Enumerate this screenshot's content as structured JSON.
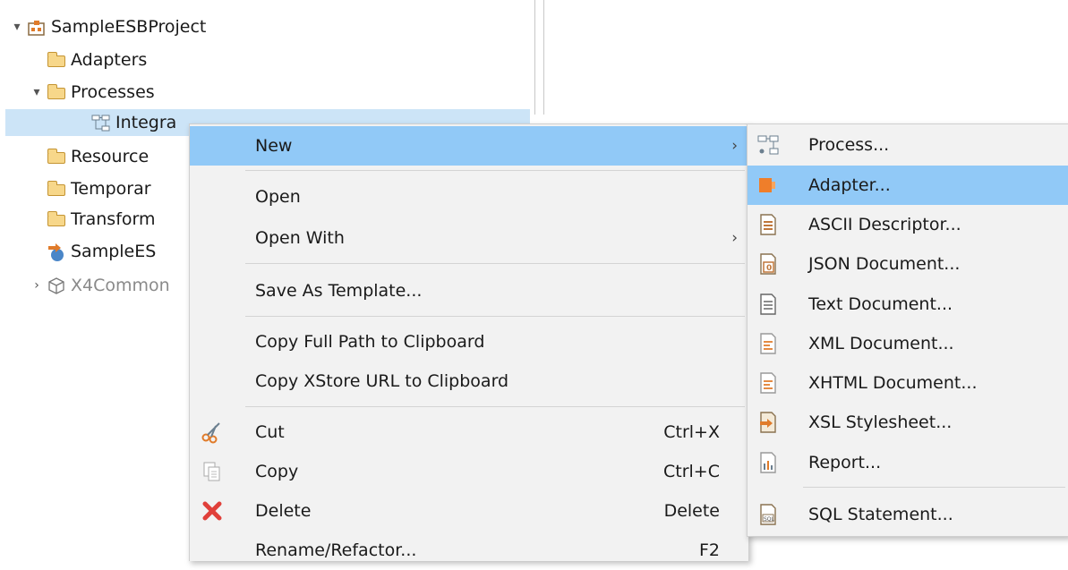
{
  "tree": {
    "items": [
      {
        "label": "SampleESBProject",
        "twisty": "▾",
        "icon": "project-icon"
      },
      {
        "label": "Adapters",
        "twisty": "",
        "icon": "folder-icon"
      },
      {
        "label": "Processes",
        "twisty": "▾",
        "icon": "folder-icon"
      },
      {
        "label": "Integration Flow.xpf",
        "visible_label": "Integra",
        "twisty": "",
        "icon": "process-icon"
      },
      {
        "label": "Resource",
        "twisty": "",
        "icon": "folder-icon"
      },
      {
        "label": "Temporar",
        "twisty": "",
        "icon": "folder-icon"
      },
      {
        "label": "Transform",
        "twisty": "",
        "icon": "folder-icon"
      },
      {
        "label": "SampleES",
        "twisty": "",
        "icon": "deploy-icon"
      },
      {
        "label": "X4Common",
        "twisty": "›",
        "icon": "package-icon"
      }
    ]
  },
  "context_menu": {
    "items": [
      {
        "label": "New",
        "shortcut": "",
        "submenu": true,
        "highlighted": true
      },
      {
        "label": "Open",
        "shortcut": "",
        "submenu": false
      },
      {
        "label": "Open With",
        "shortcut": "",
        "submenu": true
      },
      {
        "label": "Save As Template...",
        "shortcut": "",
        "submenu": false
      },
      {
        "label": "Copy Full Path to Clipboard",
        "shortcut": "",
        "submenu": false
      },
      {
        "label": "Copy XStore URL to Clipboard",
        "shortcut": "",
        "submenu": false
      },
      {
        "label": "Cut",
        "shortcut": "Ctrl+X",
        "icon": "scissors-icon"
      },
      {
        "label": "Copy",
        "shortcut": "Ctrl+C",
        "icon": "copy-icon"
      },
      {
        "label": "Delete",
        "shortcut": "Delete",
        "icon": "delete-icon"
      },
      {
        "label": "Rename/Refactor...",
        "shortcut": "F2"
      }
    ],
    "submenu_arrow": "›"
  },
  "new_submenu": {
    "items": [
      {
        "label": "Process...",
        "icon": "process-icon"
      },
      {
        "label": "Adapter...",
        "icon": "adapter-icon",
        "highlighted": true
      },
      {
        "label": "ASCII Descriptor...",
        "icon": "ascii-descriptor-icon"
      },
      {
        "label": "JSON Document...",
        "icon": "json-document-icon"
      },
      {
        "label": "Text Document...",
        "icon": "text-document-icon"
      },
      {
        "label": "XML Document...",
        "icon": "xml-document-icon"
      },
      {
        "label": "XHTML Document...",
        "icon": "xhtml-document-icon"
      },
      {
        "label": "XSL Stylesheet...",
        "icon": "xsl-stylesheet-icon"
      },
      {
        "label": "Report...",
        "icon": "report-icon"
      },
      {
        "label": "SQL Statement...",
        "icon": "sql-statement-icon"
      }
    ]
  },
  "colors": {
    "selection": "#cce4f7",
    "menu_highlight": "#91c9f7",
    "menu_background": "#f2f2f2",
    "delete_red": "#e0403a",
    "adapter_orange": "#ef7e2a"
  }
}
